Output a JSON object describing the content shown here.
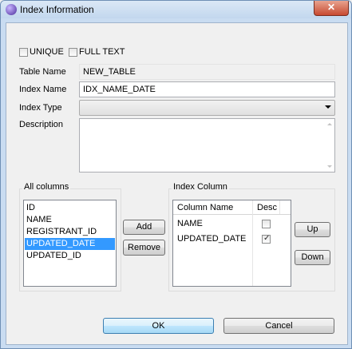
{
  "window": {
    "title": "Index Information",
    "close_glyph": "✕"
  },
  "options": {
    "unique_label": "UNIQUE",
    "unique_checked": false,
    "full_text_label": "FULL TEXT",
    "full_text_checked": false
  },
  "fields": {
    "table_name_label": "Table Name",
    "table_name_value": "NEW_TABLE",
    "index_name_label": "Index Name",
    "index_name_value": "IDX_NAME_DATE",
    "index_type_label": "Index Type",
    "index_type_value": "",
    "description_label": "Description",
    "description_value": ""
  },
  "all_columns": {
    "label": "All columns",
    "items": [
      "ID",
      "NAME",
      "REGISTRANT_ID",
      "UPDATED_DATE",
      "UPDATED_ID"
    ],
    "selected_index": 3
  },
  "middle_buttons": {
    "add": "Add",
    "remove": "Remove"
  },
  "index_column": {
    "label": "Index Column",
    "headers": {
      "column_name": "Column Name",
      "desc": "Desc"
    },
    "rows": [
      {
        "name": "NAME",
        "desc": false
      },
      {
        "name": "UPDATED_DATE",
        "desc": true
      }
    ]
  },
  "order_buttons": {
    "up": "Up",
    "down": "Down"
  },
  "footer": {
    "ok": "OK",
    "cancel": "Cancel"
  },
  "icons": {
    "app": "app-icon",
    "close": "close-icon",
    "dropdown": "chevron-down-icon",
    "check": "checkmark-icon"
  }
}
